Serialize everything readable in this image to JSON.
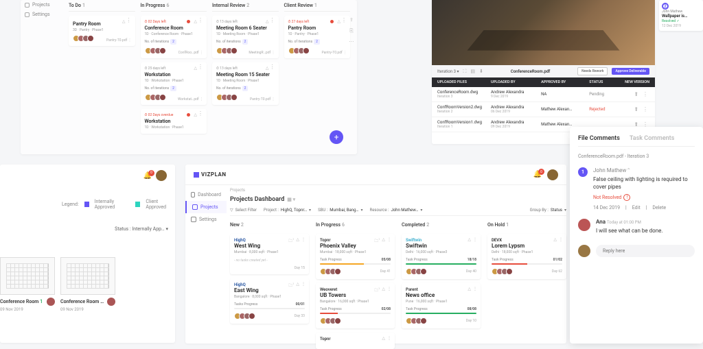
{
  "p1": {
    "sidebar": [
      {
        "icon": "projects",
        "label": "Projects"
      },
      {
        "icon": "settings",
        "label": "Settings"
      }
    ],
    "columns": [
      {
        "title": "To Do",
        "count": 1,
        "cards": [
          {
            "due": "",
            "title": "Pantry Room",
            "sub": "3D · Pantry · Phase1",
            "iter": "",
            "file": "Pantry-T0.pdf",
            "red": false,
            "avs": 4
          }
        ]
      },
      {
        "title": "In Progress",
        "count": 6,
        "cards": [
          {
            "due": "02 Days left",
            "title": "Conference Room",
            "sub": "1D · Conference Room · Phase1",
            "iter": "No. of iterations",
            "iterN": "2",
            "file": "ConfRoo…pdf",
            "red": true,
            "avs": 4
          },
          {
            "due": "25 days left",
            "title": "Workstation",
            "sub": "1D · Workstation · Phase1",
            "iter": "No. of iterations",
            "iterN": "2",
            "file": "Workstat…pdf",
            "red": false,
            "avs": 4
          },
          {
            "due": "02 Days overdue",
            "title": "Workstation",
            "sub": "1D · Workstation · Phase1",
            "iter": "",
            "file": "",
            "red": true,
            "avs": 0
          }
        ]
      },
      {
        "title": "Internal Review",
        "count": 2,
        "cards": [
          {
            "due": "13 days left",
            "title": "Meeting Room 6 Seater",
            "sub": "1D · Meeting Room · Phase1",
            "iter": "No. of iterations",
            "iterN": "2",
            "file": "MeetingR…pdf",
            "red": false,
            "avs": 4
          },
          {
            "due": "13 days left",
            "title": "Meeting Room 15 Seater",
            "sub": "1D · Meeting Room · Phase1",
            "iter": "No. of iterations",
            "iterN": "2",
            "file": "Pantry-T0.pdf",
            "red": false,
            "avs": 4
          }
        ]
      },
      {
        "title": "Client Review",
        "count": 1,
        "cards": [
          {
            "due": "27 days left",
            "title": "Pantry Room",
            "sub": "1D · Pantry · Phase1",
            "iter": "No. of iterations",
            "iterN": "2",
            "file": "Pantry-T0.pdf",
            "red": true,
            "avs": 4
          }
        ]
      }
    ]
  },
  "p2": {
    "notif_count": "0",
    "legend_label": "Legend:",
    "legends": [
      {
        "color": "#6455f5",
        "label": "Internally Approved"
      },
      {
        "color": "#2dd4bf",
        "label": "Client Approved"
      }
    ],
    "status_label": "Status :",
    "status_value": "Internally App…",
    "thumbs": [
      {
        "title": "Conference Room",
        "num": "1",
        "date": "09 Nov 2019"
      },
      {
        "title": "Conference Room …",
        "num": "",
        "date": "09 Nov 2019"
      }
    ]
  },
  "p3": {
    "logo": "VIZPLAN",
    "crumb": "Projects",
    "title": "Projects Dashboard",
    "filters": {
      "select": "Select Filter",
      "project_l": "Project :",
      "project_v": "HighQ, Topnr…",
      "sbu_l": "SBU :",
      "sbu_v": "Mumbai, Bang…",
      "resource_l": "Resource :",
      "resource_v": "John Mathew…",
      "group_l": "Group By :",
      "group_v": "Status"
    },
    "sidebar": [
      {
        "icon": "dashboard",
        "label": "Dashboard",
        "active": false
      },
      {
        "icon": "projects",
        "label": "Projects",
        "active": true
      },
      {
        "icon": "settings",
        "label": "Settings",
        "active": false
      }
    ],
    "columns": [
      {
        "title": "New",
        "count": 2,
        "cards": [
          {
            "brand": "HighQ",
            "brand_cls": "hq",
            "title": "West Wing",
            "sub": "Mumbai · 8,000 sqft · Phase1",
            "prog": "- no tasks created yet -",
            "avs": 0,
            "day": "Day 15",
            "fold": "1",
            "bar": null
          },
          {
            "brand": "HighQ",
            "brand_cls": "hq",
            "title": "East Wing",
            "sub": "Bangalore · 8,000 sqft · Phase1",
            "prog": "Tasks Progress",
            "progR": "00/01",
            "avs": 4,
            "day": "Day 33",
            "fold": "1",
            "bar": {
              "color": "#bbb",
              "pct": 0
            }
          }
        ]
      },
      {
        "title": "In Progress",
        "count": 6,
        "cards": [
          {
            "brand": "Topnr",
            "brand_cls": "tp",
            "title": "Phoenix Valley",
            "sub": "Mumbai · 18,000 sqft · Phase1",
            "prog": "Task Progress",
            "progR": "05/08",
            "avs": 4,
            "day": "Day 41",
            "fold": "1",
            "bar": {
              "color": "#f5a623",
              "pct": 62
            }
          },
          {
            "brand": "Weoveret",
            "brand_cls": "wv",
            "title": "UB Towers",
            "sub": "Bangalore · 16,000 sqft · Phase1",
            "prog": "Task Progress",
            "progR": "02/08",
            "avs": 4,
            "day": "",
            "fold": "1",
            "bar": {
              "color": "#e74c3c",
              "pct": 25
            }
          },
          {
            "brand": "Topnr",
            "brand_cls": "tp",
            "title": "",
            "sub": "",
            "prog": "",
            "avs": 0,
            "day": "",
            "fold": "",
            "bar": null
          }
        ]
      },
      {
        "title": "Completed",
        "count": 2,
        "cards": [
          {
            "brand": "Swiftwin",
            "brand_cls": "sw",
            "title": "Swiftwin",
            "sub": "Delhi · 16,000 sqft · Phase3",
            "prog": "Task Progress",
            "progR": "18/18",
            "avs": 4,
            "day": "Day 40",
            "fold": "",
            "bar": {
              "color": "#27ae60",
              "pct": 100
            }
          },
          {
            "brand": "Parent",
            "brand_cls": "pt",
            "title": "News office",
            "sub": "Pune · 16,000 sqft · Phase1",
            "prog": "Task Progress",
            "progR": "08/08",
            "avs": 4,
            "day": "Day 10",
            "fold": "",
            "bar": {
              "color": "#27ae60",
              "pct": 100
            }
          }
        ]
      },
      {
        "title": "On Hold",
        "count": 1,
        "cards": [
          {
            "brand": "DEVX",
            "brand_cls": "dv",
            "title": "Lorem Lypsm",
            "sub": "Delhi · 18,000 sqft · Phase1",
            "prog": "Task Progress",
            "progR": "01/02",
            "avs": 4,
            "day": "Day 62",
            "fold": "",
            "bar": {
              "color": "#e74c3c",
              "pct": 50
            }
          }
        ]
      }
    ]
  },
  "p4": {
    "iteration": "Iteration 3",
    "filename": "ConferenceRoom.pdf",
    "btn_rework": "Needs Rework",
    "btn_approve": "Approve Deliverable",
    "thead": [
      "UPLOADED FILES",
      "UPLOADED BY",
      "APPROVED BY",
      "STATUS",
      "NEW VERSION"
    ],
    "rows": [
      {
        "file": "ConferenceRoom.dwg",
        "iter": "Iteration 3",
        "by": "Andrew Alexandra",
        "date": "9 Dec 2019",
        "appr": "NA",
        "status": "Pending",
        "status_cls": "pending"
      },
      {
        "file": "ConfRoomVersion2.dwg",
        "iter": "Iteration 2",
        "by": "Andrew Alexandra",
        "date": "06 Dec 2019",
        "appr": "Mathew Alexan…",
        "status": "Rejected",
        "status_cls": "rejected"
      },
      {
        "file": "ConfRoomVersion1.dwg",
        "iter": "Iteration 1",
        "by": "Andrew Alexandra",
        "date": "09 Dec 2019",
        "appr": "Mathew Alexan…",
        "status": "",
        "status_cls": ""
      }
    ]
  },
  "p5": {
    "num": "2",
    "name": "John Mathew",
    "title": "Wallpaper is…",
    "status": "Resolved",
    "date": "12 Dec 2019"
  },
  "p6": {
    "tabs": [
      "File Comments",
      "Task Comments"
    ],
    "subtitle": "ConferenceRoom.pdf - Iteration 3",
    "comments": [
      {
        "num": "1",
        "name": "John Mathew",
        "text": "False ceiling with lighting is required to cover pipes",
        "resolved": "Not Resolved",
        "date": "14 Dec 2019",
        "actions": [
          "Edit",
          "Delete"
        ]
      },
      {
        "name": "Ana",
        "time": "Today at 01:00 PM",
        "text": "I will see what can be done."
      }
    ],
    "reply_placeholder": "Reply here"
  }
}
